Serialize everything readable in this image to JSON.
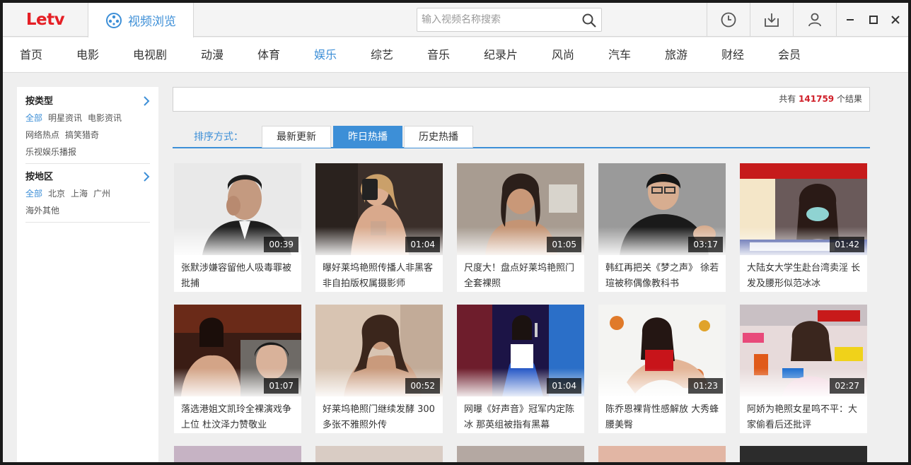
{
  "brand": {
    "logo": "Letv"
  },
  "header": {
    "active_tab": "视频浏览",
    "search_placeholder": "输入视频名称搜索"
  },
  "nav": {
    "items": [
      "首页",
      "电影",
      "电视剧",
      "动漫",
      "体育",
      "娱乐",
      "综艺",
      "音乐",
      "纪录片",
      "风尚",
      "汽车",
      "旅游",
      "财经",
      "会员"
    ],
    "active": "娱乐"
  },
  "sidebar": {
    "groups": [
      {
        "title": "按类型",
        "links": [
          "全部",
          "明星资讯",
          "电影资讯",
          "网络热点",
          "搞笑猎奇",
          "乐视娱乐播报"
        ]
      },
      {
        "title": "按地区",
        "links": [
          "全部",
          "北京",
          "上海",
          "广州",
          "海外其他"
        ]
      }
    ]
  },
  "results": {
    "prefix": "共有",
    "count": "141759",
    "suffix": "个结果"
  },
  "sort": {
    "label": "排序方式：",
    "tabs": [
      "最新更新",
      "昨日热播",
      "历史热播"
    ],
    "active": "昨日热播"
  },
  "videos": [
    {
      "title": "张默涉嫌容留他人吸毒罪被批捕",
      "duration": "00:39"
    },
    {
      "title": "曝好莱坞艳照传播人非黑客 非自拍版权属摄影师",
      "duration": "01:04"
    },
    {
      "title": "尺度大！盘点好莱坞艳照门全套裸照",
      "duration": "01:05"
    },
    {
      "title": "韩红再把关《梦之声》 徐若瑄被称偶像教科书",
      "duration": "03:17"
    },
    {
      "title": "大陆女大学生赴台湾卖淫 长发及腰形似范冰冰",
      "duration": "01:42"
    },
    {
      "title": "落选港姐文凯玲全裸演戏争上位 杜汶泽力赞敬业",
      "duration": "01:07"
    },
    {
      "title": "好莱坞艳照门继续发酵 300多张不雅照外传",
      "duration": "00:52"
    },
    {
      "title": "网曝《好声音》冠军内定陈冰 那英组被指有黑幕",
      "duration": "01:04"
    },
    {
      "title": "陈乔恩裸背性感解放 大秀蜂腰美臀",
      "duration": "01:23"
    },
    {
      "title": "阿娇为艳照女星鸣不平：大家偷看后还批评",
      "duration": "02:27"
    }
  ],
  "colors": {
    "accent": "#3d8fd7",
    "brand": "#e51f25",
    "count": "#d0202a"
  }
}
